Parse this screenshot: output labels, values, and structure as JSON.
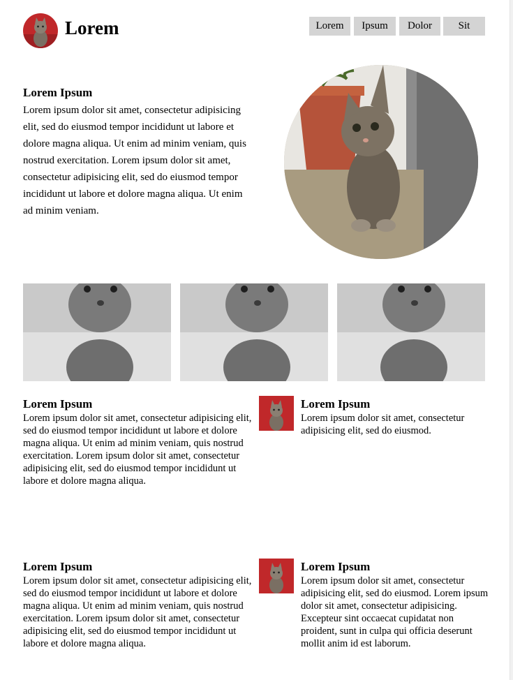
{
  "header": {
    "brand": "Lorem",
    "nav": [
      "Lorem",
      "Ipsum",
      "Dolor",
      "Sit"
    ]
  },
  "hero": {
    "title": "Lorem Ipsum",
    "body": "Lorem ipsum dolor sit amet, consectetur adipisicing elit, sed do eiusmod tempor incididunt ut labore et dolore magna aliqua. Ut enim ad minim veniam, quis nostrud exercitation. Lorem ipsum dolor sit amet, consectetur adipisicing elit, sed do eiusmod tempor incididunt ut labore et dolore magna aliqua. Ut enim ad minim veniam."
  },
  "blocks": [
    {
      "title": "Lorem Ipsum",
      "body": "Lorem ipsum dolor sit amet, consectetur adipisicing elit, sed do eiusmod tempor incididunt ut labore et dolore magna aliqua. Ut enim ad minim veniam, quis nostrud exercitation. Lorem ipsum dolor sit amet, consectetur adipisicing elit, sed do eiusmod tempor incididunt ut labore et dolore magna aliqua."
    },
    {
      "title": "Lorem Ipsum",
      "body": "Lorem ipsum dolor sit amet, consectetur adipisicing elit, sed do eiusmod."
    },
    {
      "title": "Lorem Ipsum",
      "body": "Lorem ipsum dolor sit amet, consectetur adipisicing elit, sed do eiusmod tempor incididunt ut labore et dolore magna aliqua. Ut enim ad minim veniam, quis nostrud exercitation. Lorem ipsum dolor sit amet, consectetur adipisicing elit, sed do eiusmod tempor incididunt ut labore et dolore magna aliqua."
    },
    {
      "title": "Lorem Ipsum",
      "body": "Lorem ipsum dolor sit amet, consectetur adipisicing elit, sed do eiusmod. Lorem ipsum dolor sit amet, consectetur adipisicing. Excepteur sint occaecat cupidatat non proident, sunt in culpa qui officia deserunt mollit anim id est laborum."
    }
  ],
  "colors": {
    "nav_bg": "#d4d4d4",
    "logo_bg": "#c0282a"
  }
}
